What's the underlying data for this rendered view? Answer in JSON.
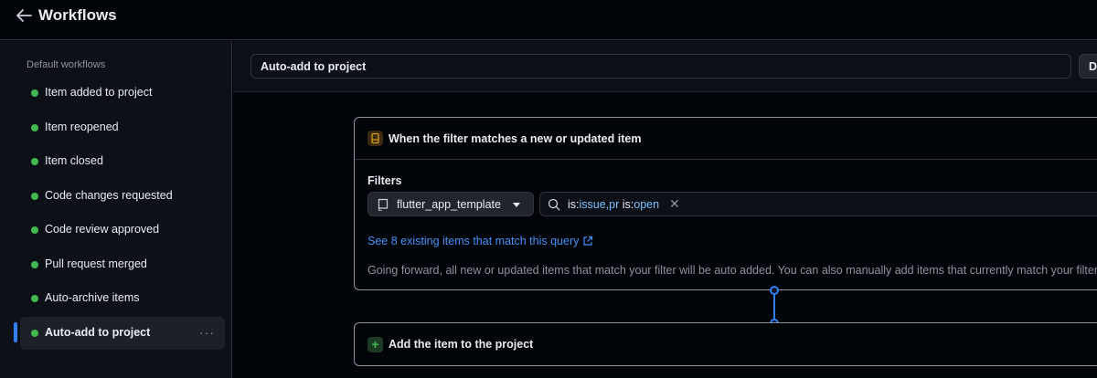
{
  "header": {
    "title": "Workflows"
  },
  "sidebar": {
    "heading": "Default workflows",
    "items": [
      {
        "label": "Item added to project"
      },
      {
        "label": "Item reopened"
      },
      {
        "label": "Item closed"
      },
      {
        "label": "Code changes requested"
      },
      {
        "label": "Code review approved"
      },
      {
        "label": "Pull request merged"
      },
      {
        "label": "Auto-archive items"
      },
      {
        "label": "Auto-add to project"
      }
    ],
    "status_color": "#3fb950"
  },
  "main": {
    "workflow_name": "Auto-add to project",
    "disable_button": "Disable",
    "trigger": {
      "title": "When the filter matches a new or updated item",
      "filters_label": "Filters",
      "repo": "flutter_app_template",
      "query": {
        "key1": "is:",
        "val1": "issue,pr",
        "key2": " is:",
        "val2": "open"
      },
      "matches_link": "See 8 existing items that match this query",
      "description": "Going forward, all new or updated items that match your filter will be auto added. You can also manually add items that currently match your filter"
    },
    "action": {
      "title": "Add the item to the project"
    }
  },
  "colors": {
    "accent": "#2f81f7",
    "link": "#4493f8",
    "success": "#3fb950",
    "background": "#010409"
  }
}
